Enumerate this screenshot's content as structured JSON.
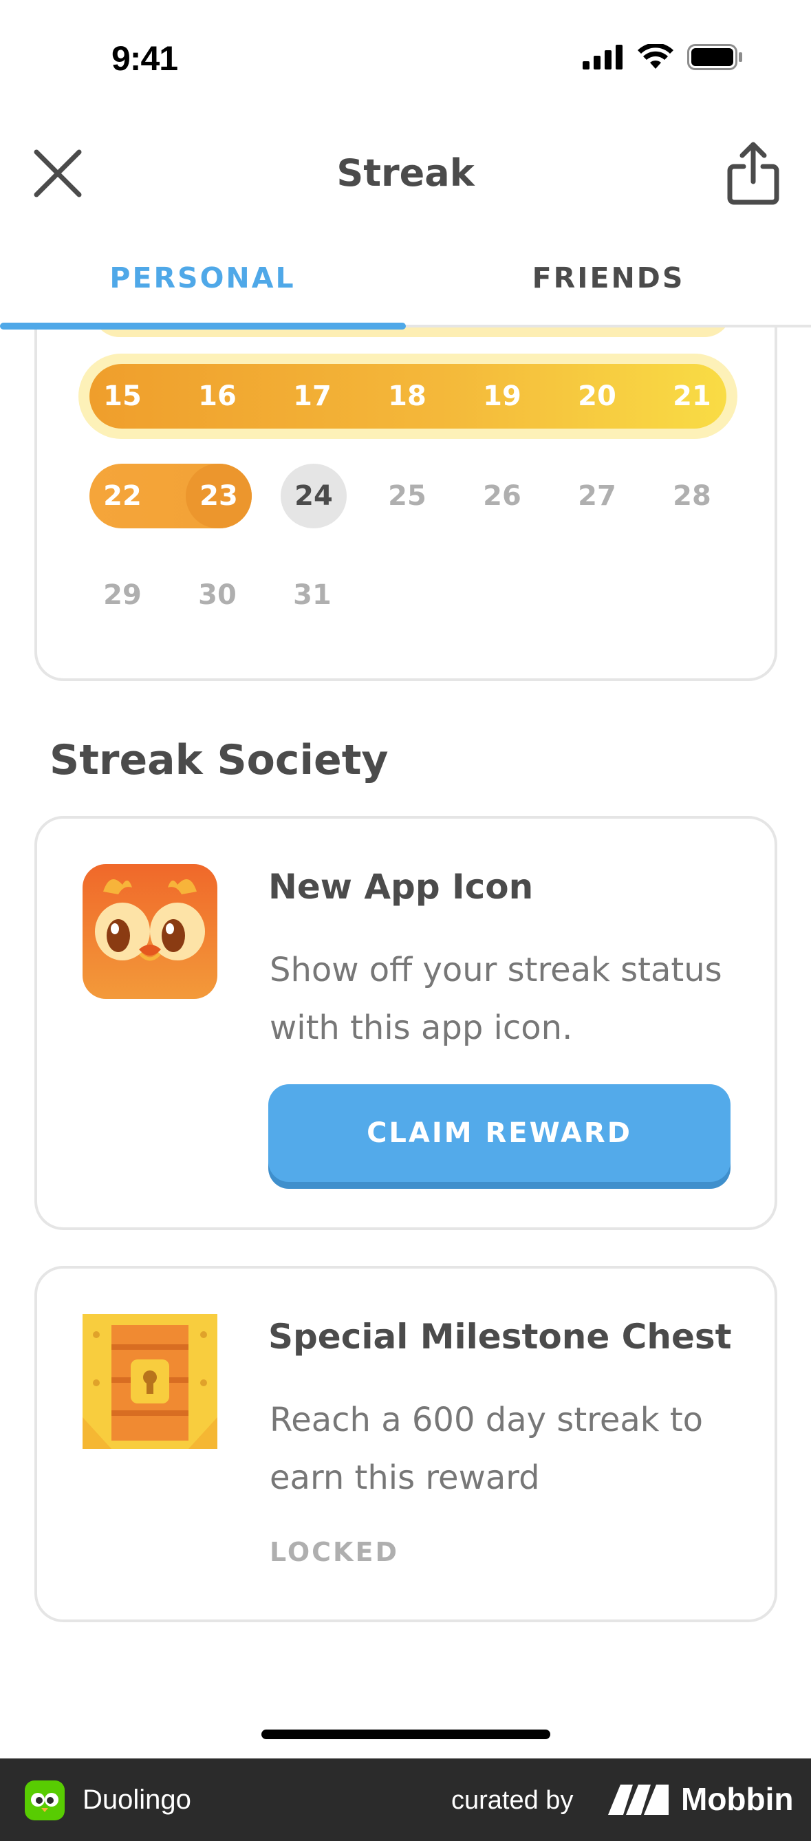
{
  "status_bar": {
    "time": "9:41"
  },
  "header": {
    "title": "Streak"
  },
  "tabs": [
    {
      "label": "PERSONAL",
      "active": true
    },
    {
      "label": "FRIENDS",
      "active": false
    }
  ],
  "calendar": {
    "rows": [
      [
        "15",
        "16",
        "17",
        "18",
        "19",
        "20",
        "21"
      ],
      [
        "22",
        "23",
        "24",
        "25",
        "26",
        "27",
        "28"
      ],
      [
        "29",
        "30",
        "31"
      ]
    ],
    "today": "24"
  },
  "section_title": "Streak Society",
  "rewards": [
    {
      "title": "New App Icon",
      "description": "Show off your streak status with this app icon.",
      "button_label": "CLAIM REWARD",
      "icon": "flame-owl-app-icon"
    },
    {
      "title": "Special Milestone Chest",
      "description": "Reach a 600 day streak to earn this reward",
      "status": "LOCKED",
      "icon": "treasure-chest-icon"
    }
  ],
  "branding": {
    "app_name": "Duolingo",
    "curated_by": "curated by",
    "curator": "Mobbin"
  },
  "colors": {
    "accent_blue": "#4fa8e8",
    "button_blue": "#53aaea",
    "streak_orange": "#ef9e2c",
    "streak_yellow": "#f9dc45",
    "text_dark": "#4b4b4b",
    "text_gray": "#777777",
    "muted_gray": "#afafaf"
  }
}
